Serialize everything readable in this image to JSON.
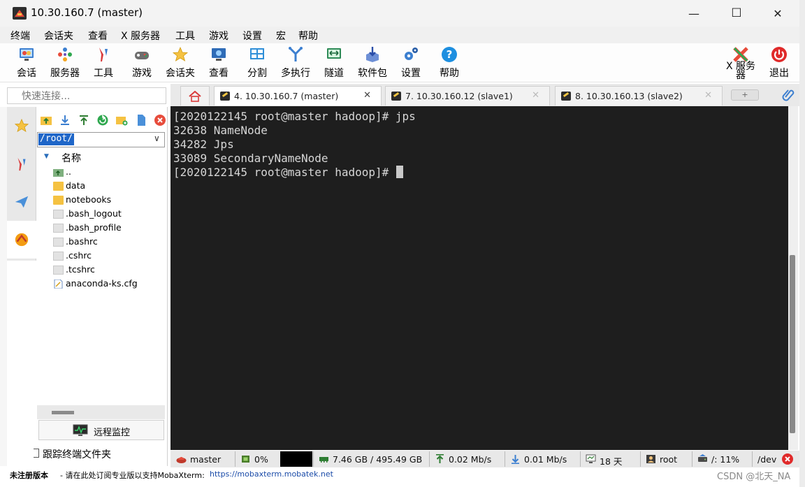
{
  "window": {
    "title": "10.30.160.7 (master)",
    "buttons": {
      "minimize": "—",
      "maximize": "☐",
      "close": "✕"
    }
  },
  "menu": [
    "终端",
    "会话夹",
    "查看",
    "X 服务器",
    "工具",
    "游戏",
    "设置",
    "宏",
    "帮助"
  ],
  "toolbar": {
    "session": "会话",
    "servers": "服务器",
    "tools": "工具",
    "games": "游戏",
    "sessions": "会话夹",
    "view": "查看",
    "split": "分割",
    "multiexec": "多执行",
    "tunneling": "隧道",
    "packages": "软件包",
    "settings": "设置",
    "help": "帮助",
    "xserver_line1": "X 服务",
    "xserver_line2": "器",
    "exit": "退出"
  },
  "quick_connect": {
    "placeholder": "快速连接..."
  },
  "tabs": [
    {
      "label": "4. 10.30.160.7 (master)",
      "active": true
    },
    {
      "label": "7. 10.30.160.12 (slave1)",
      "active": false
    },
    {
      "label": "8. 10.30.160.13 (slave2)",
      "active": false
    }
  ],
  "browser": {
    "path": "/root/",
    "column_name": "名称",
    "items": [
      {
        "name": "..",
        "kind": "up"
      },
      {
        "name": "data",
        "kind": "folder"
      },
      {
        "name": "notebooks",
        "kind": "folder"
      },
      {
        "name": ".bash_logout",
        "kind": "file"
      },
      {
        "name": ".bash_profile",
        "kind": "file"
      },
      {
        "name": ".bashrc",
        "kind": "file"
      },
      {
        "name": ".cshrc",
        "kind": "file"
      },
      {
        "name": ".tcshrc",
        "kind": "file"
      },
      {
        "name": "anaconda-ks.cfg",
        "kind": "cfg"
      }
    ],
    "remote_monitoring": "远程监控",
    "follow_terminal_folder": "跟踪终端文件夹"
  },
  "terminal": {
    "lines": [
      "[2020122145 root@master hadoop]# jps",
      "32638 NameNode",
      "34282 Jps",
      "33089 SecondaryNameNode",
      "[2020122145 root@master hadoop]# "
    ]
  },
  "status": {
    "host": "master",
    "cpu": "0%",
    "memory": "7.46 GB / 495.49 GB",
    "upload": "0.02 Mb/s",
    "download": "0.01 Mb/s",
    "uptime": "18 天",
    "user": "root",
    "disk": "/: 11%",
    "dev": "/dev"
  },
  "footer": {
    "unregistered": "未注册版本",
    "notice": " - 请在此处订阅专业版以支持MobaXterm: ",
    "url": "https://mobaxterm.mobatek.net"
  },
  "watermark": "CSDN @北天_NA",
  "colors": {
    "terminal_bg": "#1e1e1e",
    "terminal_fg": "#d6d6d6",
    "path_highlight": "#1f66c8",
    "link": "#1a4ba8"
  }
}
